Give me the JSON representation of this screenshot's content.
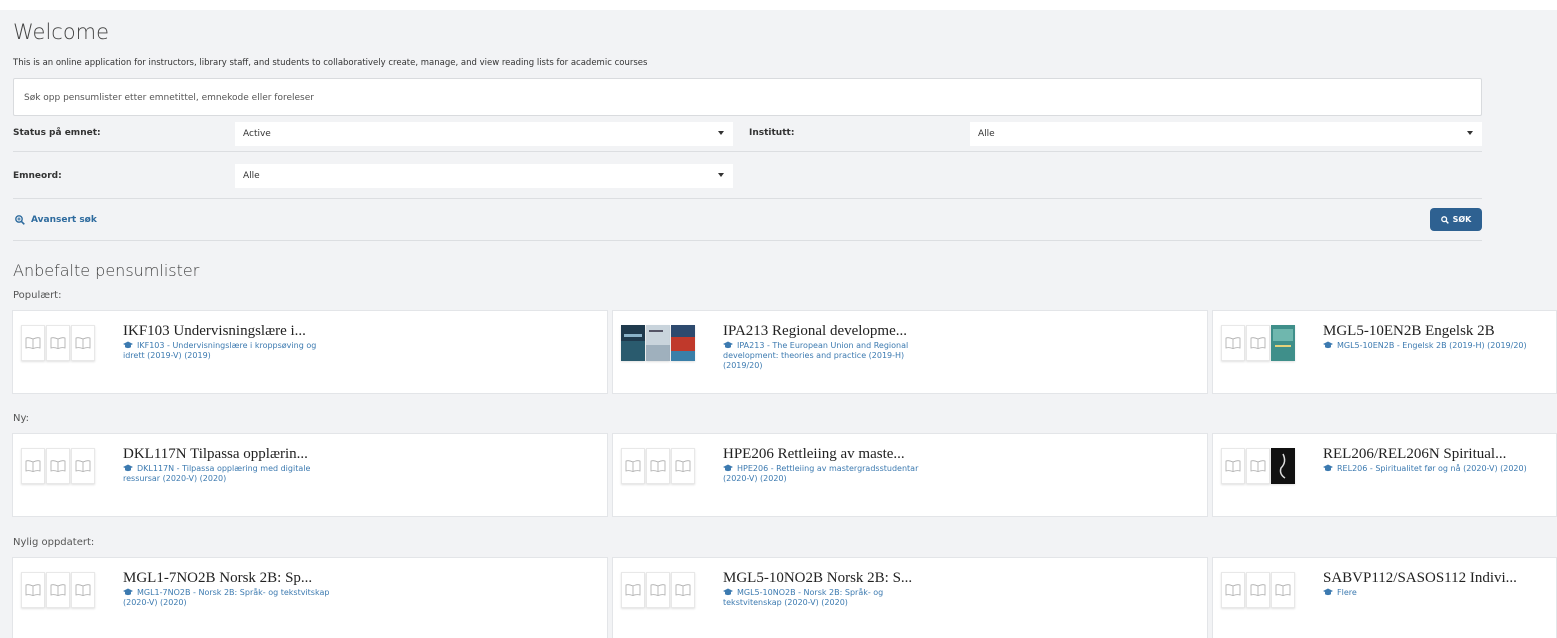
{
  "header": {
    "title": "Welcome",
    "intro": "This is an online application for instructors, library staff, and students to collaboratively create, manage, and view reading lists for academic courses"
  },
  "search": {
    "placeholder": "Søk opp pensumlister etter emnetittel, emnekode eller foreleser"
  },
  "filters": {
    "status_label": "Status på emnet:",
    "status_value": "Active",
    "institutt_label": "Institutt:",
    "institutt_value": "Alle",
    "emneord_label": "Emneord:",
    "emneord_value": "Alle"
  },
  "actions": {
    "advanced_label": "Avansert søk",
    "search_label": "SØK"
  },
  "recommended": {
    "title": "Anbefalte pensumlister",
    "sections": [
      {
        "label": "Populært:",
        "cards": [
          {
            "title": "IKF103 Undervisningslære i...",
            "subtitle": "IKF103 - Undervisningslære i kroppsøving og idrett (2019-V) (2019)"
          },
          {
            "title": "IPA213 Regional developme...",
            "subtitle": "IPA213 - The European Union and Regional development: theories and practice (2019-H) (2019/20)"
          },
          {
            "title": "MGL5-10EN2B Engelsk 2B",
            "subtitle": "MGL5-10EN2B - Engelsk 2B (2019-H) (2019/20)"
          }
        ]
      },
      {
        "label": "Ny:",
        "cards": [
          {
            "title": "DKL117N Tilpassa opplærin...",
            "subtitle": "DKL117N - Tilpassa opplæring med digitale ressursar (2020-V) (2020)"
          },
          {
            "title": "HPE206 Rettleiing av maste...",
            "subtitle": "HPE206 - Rettleiing av mastergradsstudentar (2020-V) (2020)"
          },
          {
            "title": "REL206/REL206N Spiritual...",
            "subtitle": "REL206 - Spiritualitet før og nå (2020-V) (2020)"
          }
        ]
      },
      {
        "label": "Nylig oppdatert:",
        "cards": [
          {
            "title": "MGL1-7NO2B Norsk 2B: Sp...",
            "subtitle": "MGL1-7NO2B - Norsk 2B: Språk- og tekstvitskap (2020-V) (2020)"
          },
          {
            "title": "MGL5-10NO2B Norsk 2B: S...",
            "subtitle": "MGL5-10NO2B - Norsk 2B: Språk- og tekstvitenskap (2020-V) (2020)"
          },
          {
            "title": "SABVP112/SASOS112 Indivi...",
            "subtitle": "Flere"
          }
        ]
      }
    ]
  },
  "colors": {
    "accent": "#2e6191",
    "link": "#3c7ab0",
    "panel_bg": "#f2f3f5"
  },
  "icons": {
    "advanced": "search-plus-icon",
    "search_button": "search-icon",
    "course": "graduation-cap-icon",
    "book": "open-book-icon"
  }
}
